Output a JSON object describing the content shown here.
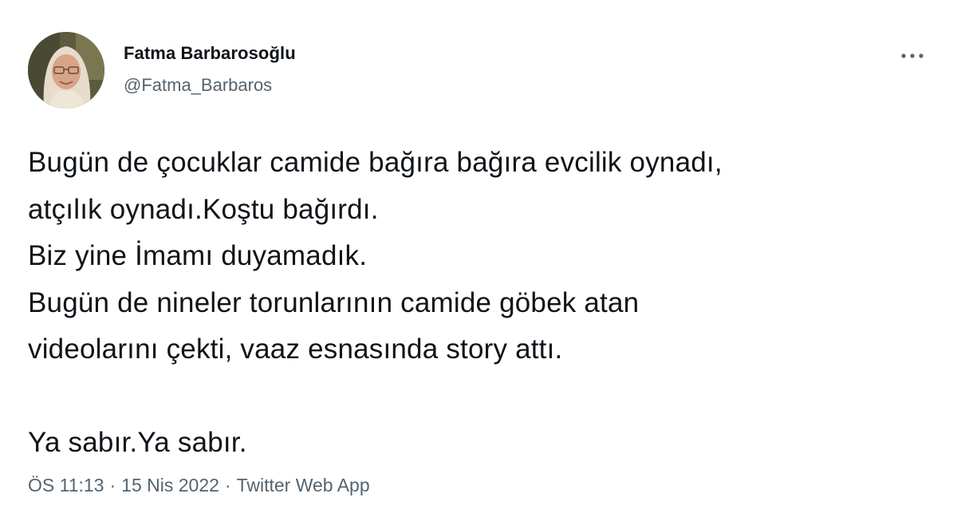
{
  "author": {
    "display_name": "Fatma Barbarosoğlu",
    "handle": "@Fatma_Barbaros",
    "avatar_icon": "profile-photo"
  },
  "more_icon": "more-horizontal-icon",
  "tweet": {
    "lines": [
      "Bugün de çocuklar camide bağıra bağıra evcilik oynadı,",
      "atçılık oynadı.Koştu bağırdı.",
      "Biz yine İmamı duyamadık.",
      "Bugün de nineler torunlarının camide göbek atan",
      "videolarını çekti, vaaz esnasında story attı.",
      "",
      "Ya sabır.Ya sabır."
    ]
  },
  "meta": {
    "time": "ÖS 11:13",
    "separator": "·",
    "date": "15 Nis 2022",
    "source": "Twitter Web App"
  },
  "colors": {
    "text_primary": "#0f1419",
    "text_secondary": "#536471",
    "background": "#ffffff"
  }
}
